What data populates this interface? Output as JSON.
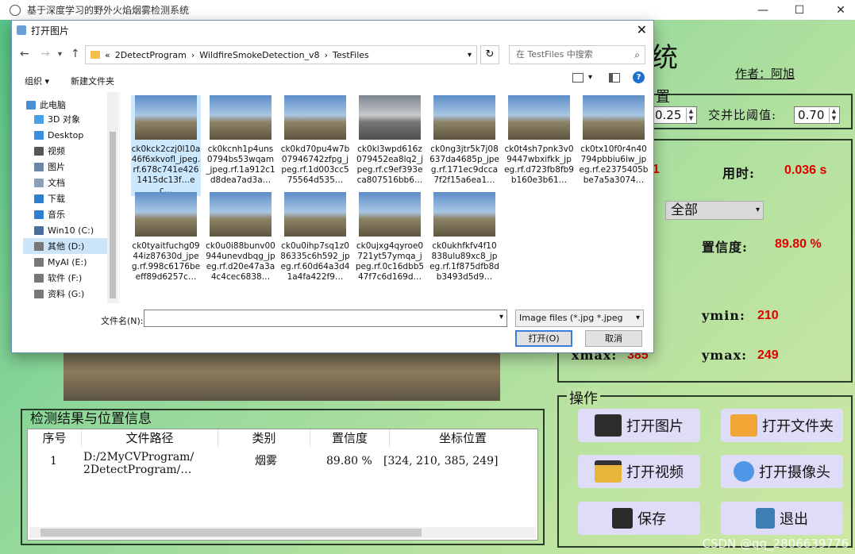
{
  "app": {
    "title": "基于深度学习的野外火焰烟雾检测系统",
    "heading_partial": "统",
    "author": "作者：阿旭"
  },
  "settings": {
    "legend_partial": "置",
    "conf_value": "0.25",
    "iou_label": "交并比阈值:",
    "iou_value": "0.70"
  },
  "results": {
    "count_partial": "1",
    "time_label": "用时:",
    "time_value": "0.036 s",
    "target_select": "全部",
    "conf_label": "置信度:",
    "conf_value": "89.80 %",
    "xmax_label": "xmax:",
    "xmax_value": "385",
    "ymin_label": "ymin:",
    "ymin_value": "210",
    "ymax_label": "ymax:",
    "ymax_value": "249"
  },
  "ops": {
    "legend": "操作",
    "open_image": "打开图片",
    "open_folder": "打开文件夹",
    "open_video": "打开视频",
    "open_camera": "打开摄像头",
    "save": "保存",
    "exit": "退出"
  },
  "table": {
    "legend": "检测结果与位置信息",
    "headers": [
      "序号",
      "文件路径",
      "类别",
      "置信度",
      "坐标位置"
    ],
    "rows": [
      {
        "index": "1",
        "path": "D:/2MyCVProgram/\n2DetectProgram/…",
        "class": "烟雾",
        "conf": "89.80 %",
        "coords": "[324, 210, 385, 249]"
      }
    ]
  },
  "dialog": {
    "title": "打开图片",
    "breadcrumb": [
      "«",
      "2DetectProgram",
      "›",
      "WildfireSmokeDetection_v8",
      "›",
      "TestFiles"
    ],
    "search_placeholder": "在 TestFiles 中搜索",
    "organize": "组织 ▾",
    "new_folder": "新建文件夹",
    "sidebar": [
      "此电脑",
      "3D 对象",
      "Desktop",
      "视频",
      "图片",
      "文档",
      "下载",
      "音乐",
      "Win10 (C:)",
      "其他 (D:)",
      "MyAI (E:)",
      "软件 (F:)",
      "资料 (G:)"
    ],
    "files": [
      "ck0kck2czj0l10a46f6xkvofl_jpeg.rf.678c741e4261415dc13f…ec…",
      "ck0kcnh1p4uns0794bs53wqam_jpeg.rf.1a912c1d8dea7ad3a…",
      "ck0kd70pu4w7b07946742zfpg_jpeg.rf.1d003cc575564d535…",
      "ck0kl3wpd616z079452ea8lq2_jpeg.rf.c9ef393eca807516bb6…",
      "ck0ng3jtr5k7j08637da4685p_jpeg.rf.171ec9dcca7f2f15a6ea1…",
      "ck0t4sh7pnk3v09447wbxifkk_jpeg.rf.d723fb8fb9b160e3b61…",
      "ck0tx10f0r4n40794pbbiu6iw_jpeg.rf.e2375405bbe7a5a3074…",
      "ck0tyaitfuchg0944iz87630d_jpeg.rf.998c6176beeff89d6257c…",
      "ck0u0i88bunv00944unevdbqg_jpeg.rf.d20e47a3a4c4cec6838…",
      "ck0u0ihp7sq1z086335c6h592_jpeg.rf.60d64a3d41a4fa422f9…",
      "ck0ujxg4qyroe0721yt57ymqa_jpeg.rf.0c16dbb547f7c6d169d…",
      "ck0ukhfkfv4f10838ulu89xc8_jpeg.rf.1f875dfb8db3493d5d9…"
    ],
    "filename_label": "文件名(N):",
    "filetype": "Image files (*.jpg *.jpeg *.pn",
    "open_button": "打开(O)",
    "cancel_button": "取消"
  },
  "watermark": "CSDN @qq_2806639776"
}
